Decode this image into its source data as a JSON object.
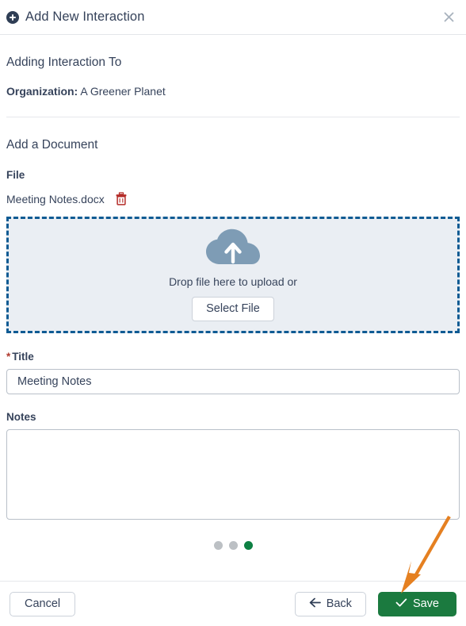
{
  "header": {
    "title": "Add New Interaction",
    "add_icon": "plus-circle-icon",
    "close_icon": "close-icon"
  },
  "body": {
    "adding_heading": "Adding Interaction To",
    "org_label": "Organization:",
    "org_value": "A Greener Planet",
    "document_heading": "Add a Document",
    "file_label": "File",
    "file_name": "Meeting Notes.docx",
    "delete_file_icon": "trash-icon",
    "dropzone": {
      "icon": "cloud-upload-icon",
      "text": "Drop file here to upload or",
      "button_label": "Select File"
    },
    "title_field": {
      "required_marker": "*",
      "label": "Title",
      "value": "Meeting Notes",
      "placeholder": ""
    },
    "notes_field": {
      "label": "Notes",
      "value": "",
      "placeholder": ""
    },
    "steps": {
      "total": 3,
      "active_index": 3,
      "inactive_color": "#bcc0c4",
      "active_color": "#0e8043"
    }
  },
  "footer": {
    "cancel_label": "Cancel",
    "back_label": "Back",
    "back_icon": "arrow-left-icon",
    "save_label": "Save",
    "save_icon": "check-icon"
  },
  "annotation": {
    "arrow_color": "#e58021",
    "points_to": "save-button"
  },
  "colors": {
    "text": "#36435b",
    "accent_green": "#1b7a3f",
    "dropzone_border": "#0f5b93",
    "dropzone_bg": "#eaeef3",
    "required_red": "#b03a2e",
    "trash_red": "#b42c28",
    "cloud_blue": "#7e9cb5"
  }
}
